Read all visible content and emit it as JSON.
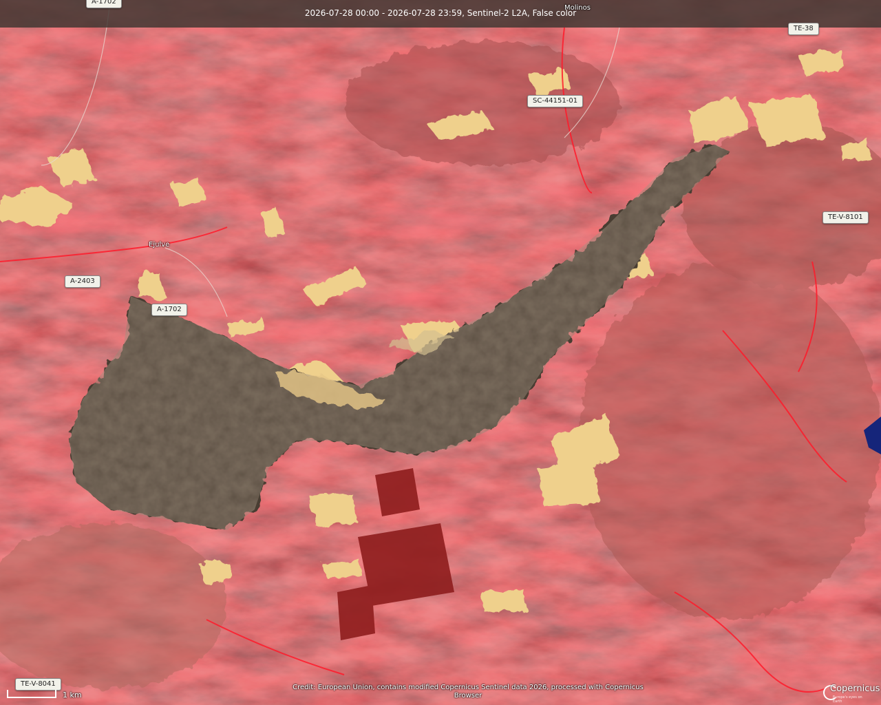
{
  "header": {
    "title": "2026-07-28 00:00 - 2026-07-28 23:59, Sentinel-2 L2A, False color"
  },
  "roads": [
    {
      "id": "a1702-top",
      "label": "A-1702"
    },
    {
      "id": "te38",
      "label": "TE-38"
    },
    {
      "id": "sc44151",
      "label": "SC-44151-01"
    },
    {
      "id": "tev8101",
      "label": "TE-V-8101"
    },
    {
      "id": "a2403",
      "label": "A-2403"
    },
    {
      "id": "a1702",
      "label": "A-1702"
    },
    {
      "id": "tev8041",
      "label": "TE-V-8041"
    }
  ],
  "places": {
    "ejulve": "Ejulve",
    "molinos": "Molinos"
  },
  "credit": "Credit: European Union, contains modified Copernicus Sentinel data 2026, processed with Copernicus Browser",
  "scale": {
    "label": "1 km"
  },
  "logo": {
    "text": "Copernicus",
    "subtitle": "Europe's eyes on Earth"
  },
  "colors": {
    "vegetation": "#c8202a",
    "burn_scar": "#4a3c30",
    "bare_fields": "#f0d088",
    "water": "#1a2a8a"
  }
}
